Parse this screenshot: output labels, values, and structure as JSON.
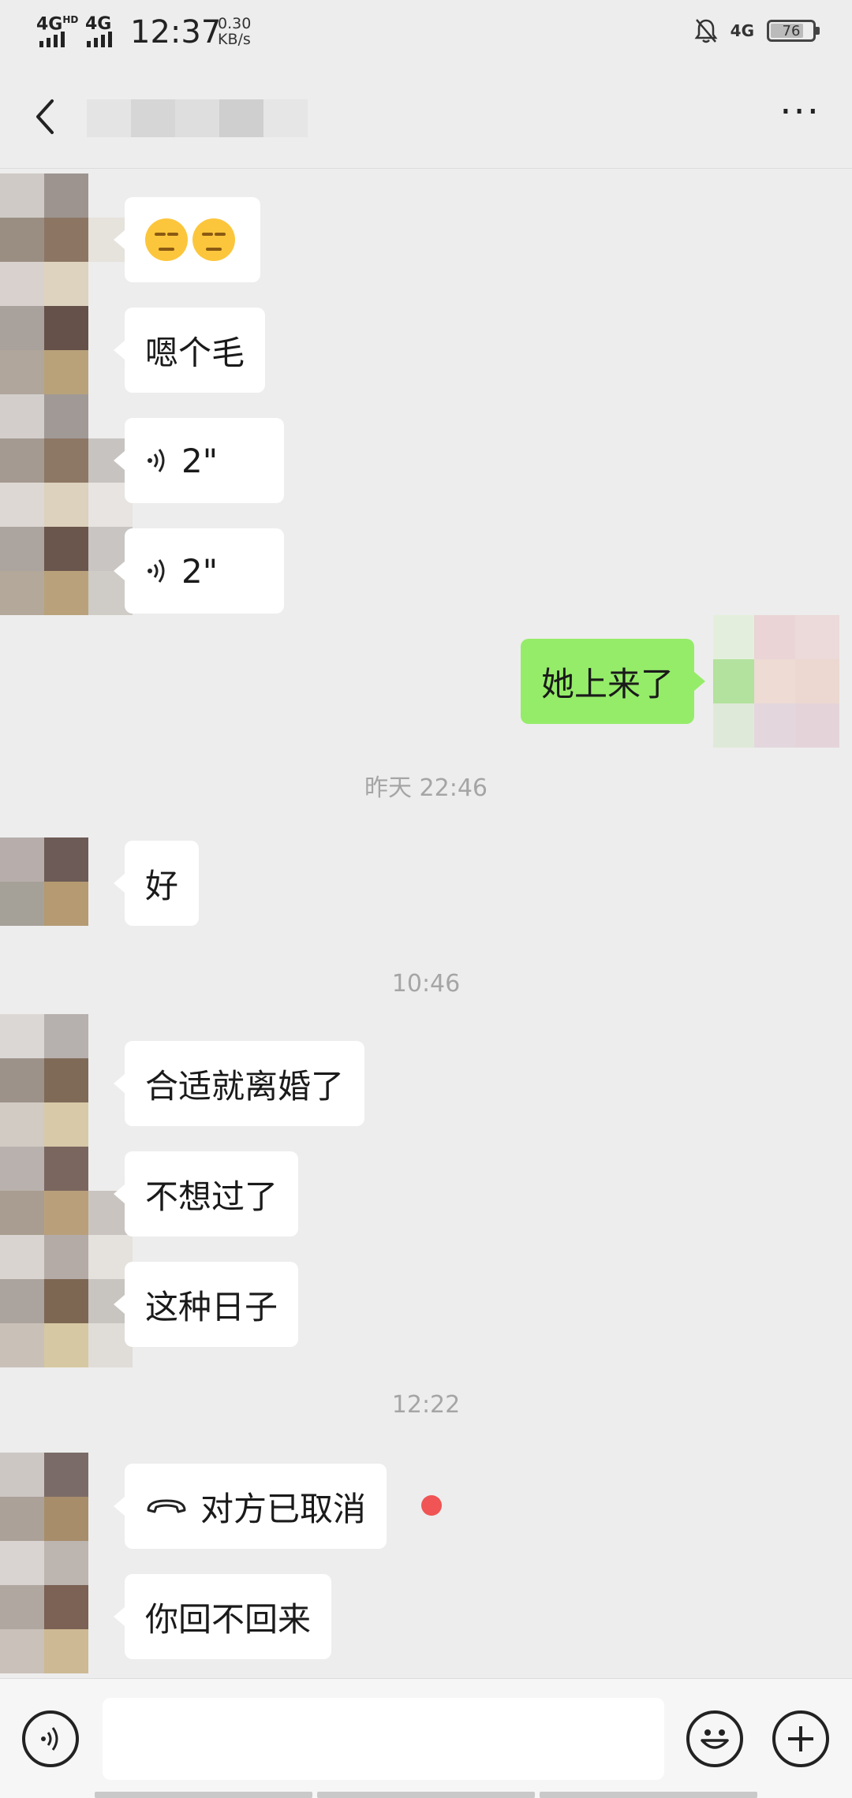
{
  "status_bar": {
    "signal1": "4G",
    "signal1_sup": "HD",
    "signal2": "4G",
    "time": "12:37",
    "net_speed_value": "0.30",
    "net_speed_unit": "KB/s",
    "right_network": "4G",
    "battery_level": "76"
  },
  "header": {
    "title": "",
    "more_label": "···"
  },
  "messages": [
    {
      "side": "left",
      "type": "emoji",
      "text": "😒😒"
    },
    {
      "side": "left",
      "type": "text",
      "text": "嗯个毛"
    },
    {
      "side": "left",
      "type": "voice",
      "duration": "2\""
    },
    {
      "side": "left",
      "type": "voice",
      "duration": "2\""
    },
    {
      "side": "right",
      "type": "text",
      "text": "她上来了"
    },
    {
      "type": "timestamp",
      "text": "昨天 22:46"
    },
    {
      "side": "left",
      "type": "text",
      "text": "好"
    },
    {
      "type": "timestamp",
      "text": "10:46"
    },
    {
      "side": "left",
      "type": "text",
      "text": "合适就离婚了"
    },
    {
      "side": "left",
      "type": "text",
      "text": "不想过了"
    },
    {
      "side": "left",
      "type": "text",
      "text": "这种日子"
    },
    {
      "type": "timestamp",
      "text": "12:22"
    },
    {
      "side": "left",
      "type": "call",
      "text": "对方已取消"
    },
    {
      "side": "left",
      "type": "text",
      "text": "你回不回来"
    }
  ],
  "input_bar": {
    "placeholder": ""
  },
  "colors": {
    "background": "#ededed",
    "my_bubble": "#95ec69",
    "other_bubble": "#ffffff",
    "timestamp": "#a5a5a5",
    "unread_dot": "#f05454"
  }
}
